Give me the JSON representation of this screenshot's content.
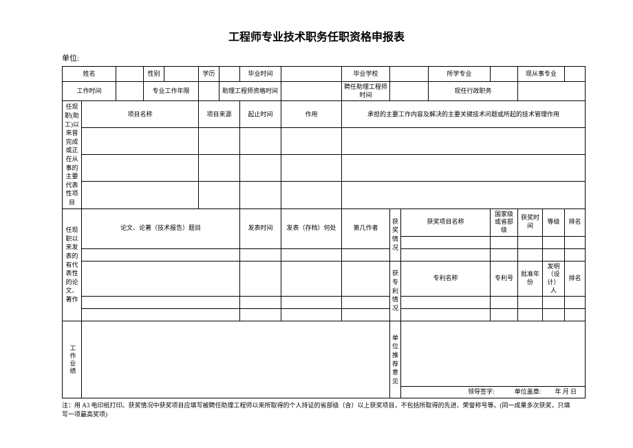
{
  "title": "工程师专业技术职务任职资格申报表",
  "unit_label": "单位:",
  "unit_value": "",
  "row1": {
    "name_label": "姓名",
    "name_value": "",
    "gender_label": "性别",
    "gender_value": "",
    "edu_label": "学历",
    "edu_value": "",
    "grad_time_label": "毕业时间",
    "grad_time_value": "",
    "grad_school_label": "毕业学校",
    "grad_school_value": "",
    "major_label": "所学专业",
    "major_value": "",
    "current_major_label": "现从事专业",
    "current_major_value": ""
  },
  "row2": {
    "work_time_label": "工作时间",
    "work_time_value": "",
    "work_years_label": "专业工作年限",
    "work_years_value": "",
    "assist_qual_time_label": "助理工程师资格时间",
    "assist_qual_time_value": "",
    "assist_appoint_time_label": "聘任助理工程师时间",
    "assist_appoint_time_value": "",
    "current_duty_label": "现任行政职务",
    "current_duty_value": ""
  },
  "projects": {
    "side_label": "任现职(助工)以来曾完成或正在从事的主要代表性项目",
    "col_name": "项目名称",
    "col_source": "项目来源",
    "col_end": "起止时间",
    "col_role": "作用",
    "col_desc": "承担的主要工作内容及解决的主要关键技术问题或所起的技术管理作用"
  },
  "papers": {
    "side_label": "任现职以来发表的有代表性的论文、著作",
    "col_title": "论文、论著（技术报告）题目",
    "col_pub_time": "发表时间",
    "col_pub_place": "发表（存档）何处",
    "col_author": "第几作者"
  },
  "awards": {
    "side_label": "获奖情况",
    "col_name": "获奖项目名称",
    "col_level": "国家级或省部级",
    "col_time": "获奖时间",
    "col_grade": "等级",
    "col_rank": "排名"
  },
  "patents": {
    "side_label": "获专利情况",
    "col_name": "专利名称",
    "col_no": "专利号",
    "col_year": "批准年份",
    "col_inventor": "发明（设计）人",
    "col_rank": "排名"
  },
  "perf": {
    "side_label": "工作业绩"
  },
  "recommend": {
    "side_label": "单位推荐意见",
    "sig_leader": "领导签字:",
    "sig_stamp": "单位盖章:",
    "sig_date": "年  月  日"
  },
  "note": "注：用 A3 电印纸打印。获奖情况中获奖项目应填写被聘任助理工程师以来所取得的个人持证的省部级（含）以上获奖项目，不包括所取得的先进、荣誉称号等。(同一成果多次获奖，只填写一项最高奖项)"
}
